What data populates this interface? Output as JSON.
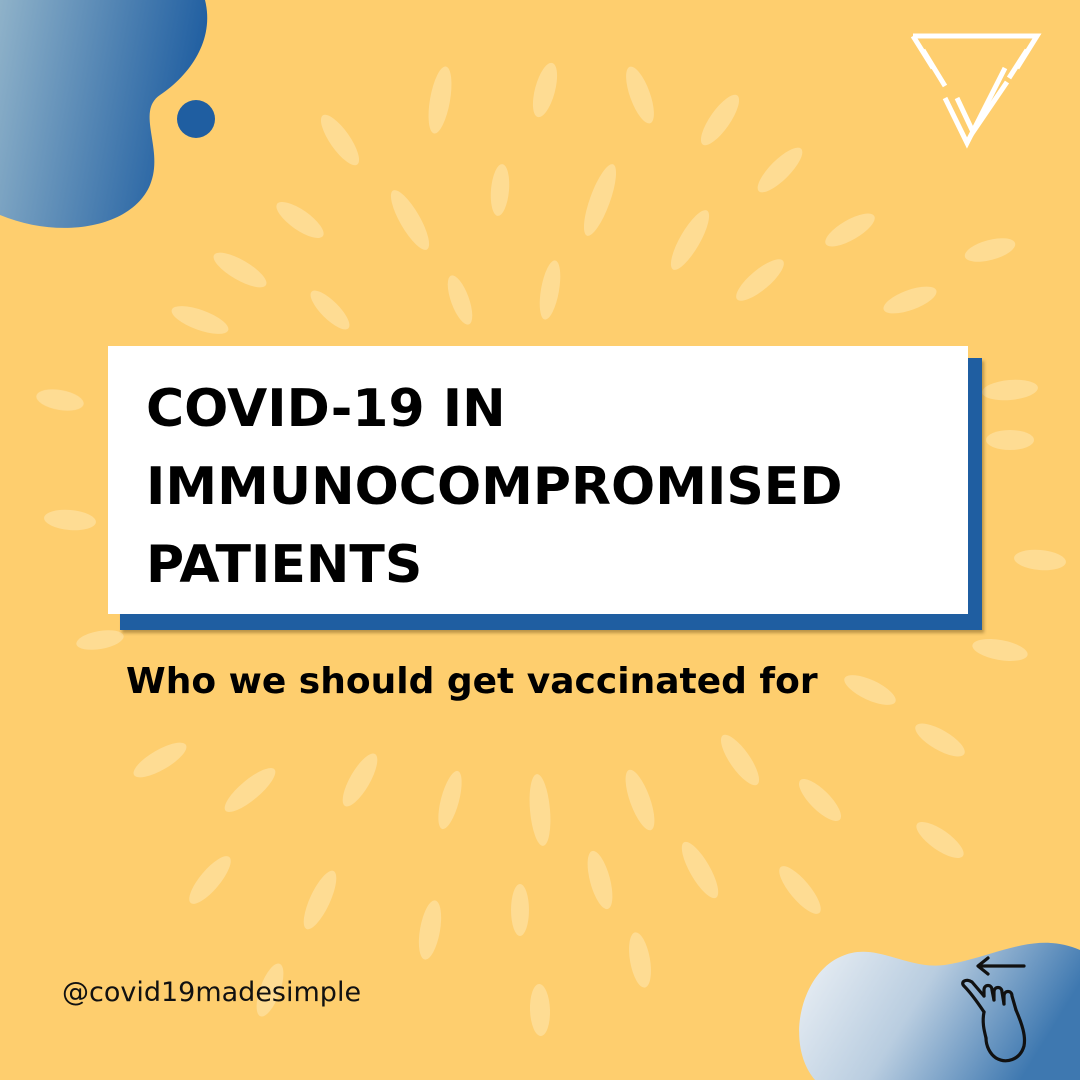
{
  "title": {
    "lines": [
      "COVID-19 IN",
      "IMMUNOCOMPROMISED",
      "PATIENTS"
    ]
  },
  "subtitle": "Who we should get vaccinated for",
  "handle": "@covid19madesimple",
  "colors": {
    "background": "#FECE6E",
    "accent_blue": "#1F5EA1",
    "card": "#FFFFFF",
    "text": "#000000"
  },
  "icons": [
    "logo-triangle-v-icon",
    "swipe-left-hand-icon"
  ]
}
